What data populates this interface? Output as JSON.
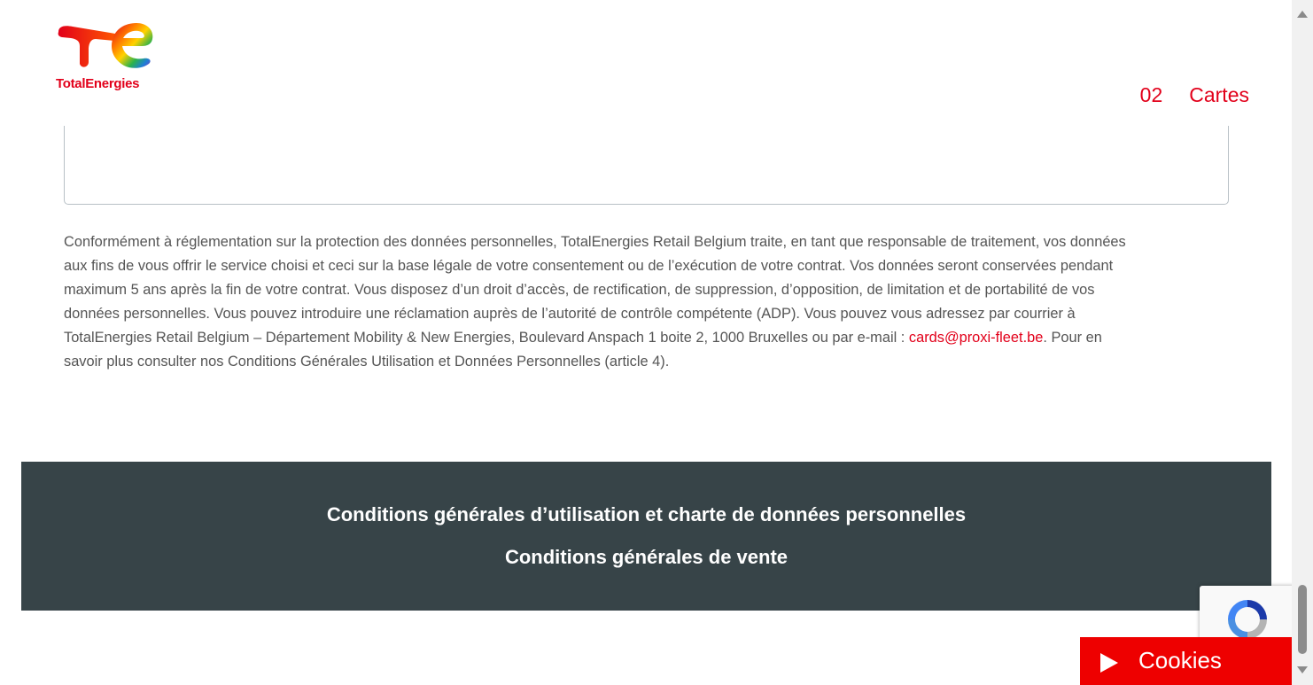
{
  "header": {
    "logo_text": "TotalEnergies",
    "step_number": "02",
    "step_label": "Cartes"
  },
  "privacy": {
    "text_before": "Conformément à réglementation sur la protection des données personnelles, TotalEnergies Retail Belgium traite, en tant que responsable de traitement, vos données aux fins de vous offrir le service choisi et ceci sur la base légale de votre consentement ou de l’exécution de votre contrat. Vos données seront conservées pendant maximum 5 ans après la fin de votre contrat. Vous disposez d’un droit d’accès, de rectification, de suppression, d’opposition, de limitation et de portabilité de vos données personnelles. Vous pouvez introduire une réclamation auprès de l’autorité de contrôle compétente (ADP).  Vous pouvez vous adressez par courrier à TotalEnergies Retail Belgium – Département Mobility & New Energies, Boulevard Anspach 1 boite 2, 1000 Bruxelles ou par e-mail : ",
    "email": "cards@proxi-fleet.be",
    "text_after": ". Pour en savoir plus consulter nos Conditions Générales Utilisation et Données Personnelles (article 4)."
  },
  "footer": {
    "link_1": "Conditions générales d’utilisation et charte de données personnelles",
    "link_2": "Conditions générales de vente"
  },
  "cookies": {
    "label": "Cookies"
  },
  "colors": {
    "brand_red": "#e2001a",
    "cookie_red": "#ee0000",
    "footer_bg": "#374448",
    "body_text": "#555555"
  },
  "icons": {
    "logo": "totalenergies-logo",
    "cookies": "play-icon",
    "captcha": "recaptcha-icon"
  }
}
